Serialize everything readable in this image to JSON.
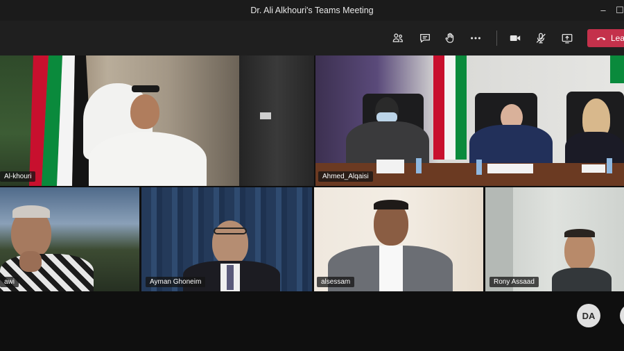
{
  "window": {
    "title": "Dr. Ali Alkhouri's Teams Meeting",
    "minimize_glyph": "–",
    "maximize_glyph": "☐"
  },
  "toolbar": {
    "icons": [
      "participants-icon",
      "chat-icon",
      "raise-hand-icon",
      "more-options-icon",
      "camera-icon",
      "mic-muted-icon",
      "share-screen-icon"
    ],
    "leave_label": "Leave",
    "leave_color": "#c4314b"
  },
  "participants": {
    "p1": "Al-khouri",
    "p2": "Ahmed_Alqaisi",
    "p3": "awi",
    "p4": "Ayman Ghoneim",
    "p5": "alsessam",
    "p6": "Rony Assaad"
  },
  "self_view": {
    "initials": "DA"
  }
}
